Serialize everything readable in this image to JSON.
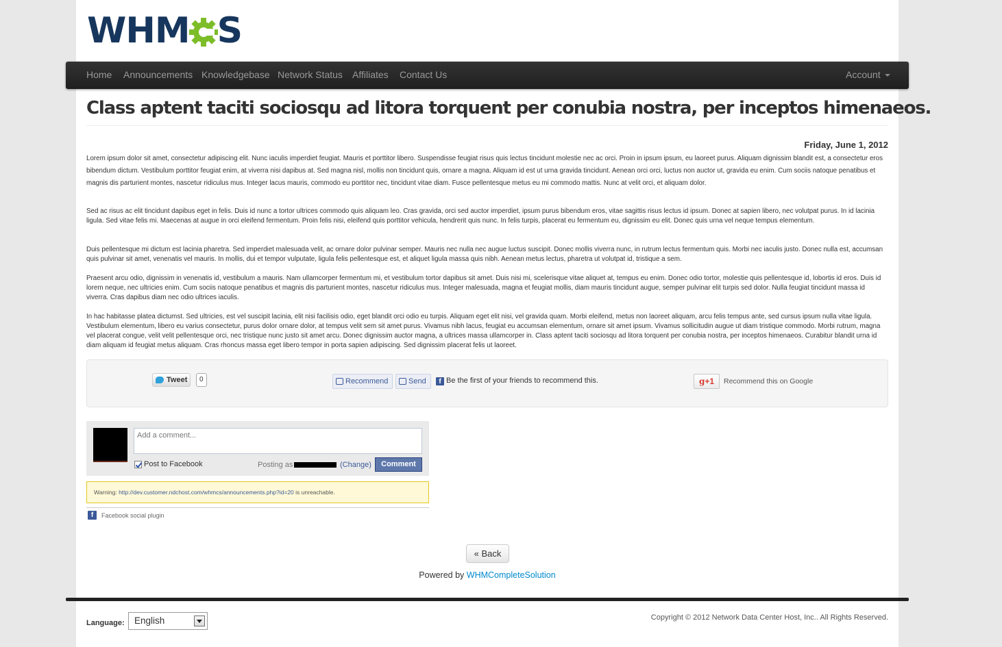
{
  "logo": {
    "left": "WHM",
    "right": "S",
    "gear_color": "#7cbd28"
  },
  "nav": {
    "items": [
      "Home",
      "Announcements",
      "Knowledgebase",
      "Network Status",
      "Affiliates",
      "Contact Us"
    ],
    "account": "Account"
  },
  "article": {
    "title": "Class aptent taciti sociosqu ad litora torquent per conubia nostra, per inceptos himenaeos.",
    "date": "Friday, June 1, 2012",
    "paragraphs": [
      "Lorem ipsum dolor sit amet, consectetur adipiscing elit. Nunc iaculis imperdiet feugiat. Mauris et porttitor libero. Suspendisse feugiat risus quis lectus tincidunt molestie nec ac orci. Proin in ipsum ipsum, eu laoreet purus. Aliquam dignissim blandit est, a consectetur eros bibendum dictum. Vestibulum porttitor feugiat enim, at viverra nisi dapibus at. Sed magna nisl, mollis non tincidunt quis, ornare a magna. Aliquam id est ut urna gravida tincidunt. Aenean orci orci, luctus non auctor ut, gravida eu enim. Cum sociis natoque penatibus et magnis dis parturient montes, nascetur ridiculus mus. Integer lacus mauris, commodo eu porttitor nec, tincidunt vitae diam. Fusce pellentesque metus eu mi commodo mattis. Nunc at velit orci, et aliquam dolor.",
      "Sed ac risus ac elit tincidunt dapibus eget in felis. Duis id nunc a tortor ultrices commodo quis aliquam leo. Cras gravida, orci sed auctor imperdiet, ipsum purus bibendum eros, vitae sagittis risus lectus id ipsum. Donec at sapien libero, nec volutpat purus. In id lacinia ligula. Sed vitae felis mi. Maecenas at augue in orci eleifend fermentum. Proin felis nisi, eleifend quis porttitor vehicula, hendrerit quis nunc. In felis turpis, placerat eu fermentum eu, dignissim eu elit. Donec quis urna vel neque tempus elementum.",
      "Duis pellentesque mi dictum est lacinia pharetra. Sed imperdiet malesuada velit, ac ornare dolor pulvinar semper. Mauris nec nulla nec augue luctus suscipit. Donec mollis viverra nunc, in rutrum lectus fermentum quis. Morbi nec iaculis justo. Donec nulla est, accumsan quis pulvinar sit amet, venenatis vel mauris. In mollis, dui et tempor vulputate, ligula felis pellentesque est, et aliquet ligula massa quis nibh. Aenean metus lectus, pharetra ut volutpat id, tristique a sem.",
      "Praesent arcu odio, dignissim in venenatis id, vestibulum a mauris. Nam ullamcorper fermentum mi, et vestibulum tortor dapibus sit amet. Duis nisi mi, scelerisque vitae aliquet at, tempus eu enim. Donec odio tortor, molestie quis pellentesque id, lobortis id eros. Duis id lorem neque, nec ultricies enim. Cum sociis natoque penatibus et magnis dis parturient montes, nascetur ridiculus mus. Integer malesuada, magna et feugiat mollis, diam mauris tincidunt augue, semper pulvinar elit turpis sed dolor. Nulla feugiat tincidunt massa id viverra. Cras dapibus diam nec odio ultrices iaculis.",
      "In hac habitasse platea dictumst. Sed ultricies, est vel suscipit lacinia, elit nisi facilisis odio, eget blandit orci odio eu turpis. Aliquam eget elit nisi, vel gravida quam. Morbi eleifend, metus non laoreet aliquam, arcu felis tempus ante, sed cursus ipsum nulla vitae ligula. Vestibulum elementum, libero eu varius consectetur, purus dolor ornare dolor, at tempus velit sem sit amet purus. Vivamus nibh lacus, feugiat eu accumsan elementum, ornare sit amet ipsum. Vivamus sollicitudin augue ut diam tristique commodo. Morbi rutrum, magna vel placerat congue, velit velit pellentesque orci, nec tristique nunc justo sit amet arcu. Donec dignissim auctor magna, a ultrices massa ullamcorper in. Class aptent taciti sociosqu ad litora torquent per conubia nostra, per inceptos himenaeos. Curabitur blandit urna id diam aliquam id feugiat metus aliquam. Cras rhoncus massa eget libero tempor in porta sapien adipiscing. Sed dignissim placerat felis ut laoreet."
    ]
  },
  "social": {
    "tweet_label": "Tweet",
    "tweet_count": "0",
    "recommend_label": "Recommend",
    "send_label": "Send",
    "fb_first_text": "Be the first of your friends to recommend this.",
    "gplus_label": "+1",
    "gplus_text": "Recommend this on Google"
  },
  "comments": {
    "placeholder": "Add a comment...",
    "post_to_facebook": "Post to Facebook",
    "posting_as": "Posting as",
    "change_label": "(Change)",
    "comment_button": "Comment",
    "warning_prefix": "Warning:",
    "warning_url": "http://dev.customer.ndchost.com/whmcs/announcements.php?id=20",
    "warning_suffix": "is unreachable.",
    "plugin_label": "Facebook social plugin"
  },
  "back_button": "« Back",
  "powered_by": {
    "prefix": "Powered by",
    "link": "WHMCompleteSolution"
  },
  "footer": {
    "language_label": "Language:",
    "language_value": "English",
    "copyright": "Copyright © 2012 Network Data Center Host, Inc.. All Rights Reserved."
  }
}
